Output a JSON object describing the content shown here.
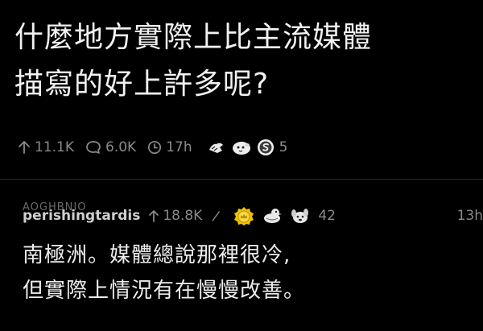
{
  "post": {
    "title_line1": "什麼地方實際上比主流媒體",
    "title_line2": "描寫的好上許多呢?",
    "upvotes": "11.1K",
    "comments": "6.0K",
    "age": "17h",
    "award_count": "5",
    "awards": [
      "helpful-hands-award-icon",
      "wholesome-seal-award-icon",
      "silver-coin-award-icon"
    ]
  },
  "comment": {
    "author": "perishingtardis",
    "author_overlay": "AOGHBNIO",
    "score": "18.8K",
    "awards": [
      "crown-medal-award-icon",
      "duck-award-icon",
      "dog-award-icon"
    ],
    "award_count": "42",
    "age": "13h",
    "body_line1": "南極洲。媒體總說那裡很冷,",
    "body_line2": "但實際上情況有在慢慢改善。"
  },
  "colors": {
    "background": "#000000",
    "text": "#ededed",
    "muted": "#8a8a8a",
    "divider": "#2a2a2a",
    "gold": "#f2c200"
  }
}
